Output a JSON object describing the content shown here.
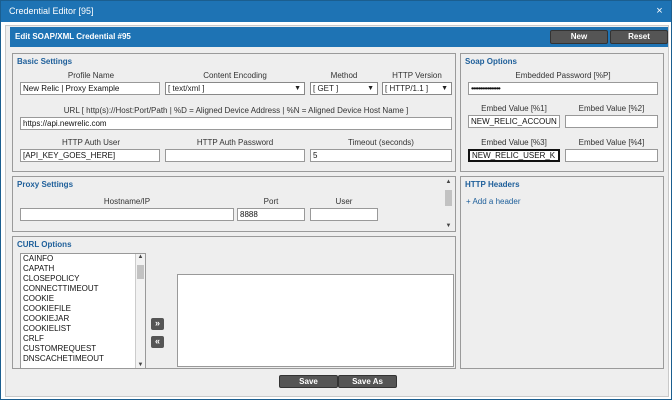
{
  "window": {
    "title": "Credential Editor [95]",
    "close": "×"
  },
  "editor": {
    "heading": "Edit SOAP/XML Credential #95",
    "new_label": "New",
    "reset_label": "Reset"
  },
  "basic": {
    "title": "Basic Settings",
    "profile_name_label": "Profile Name",
    "profile_name": "New Relic | Proxy Example",
    "content_encoding_label": "Content Encoding",
    "content_encoding": "[ text/xml ]",
    "method_label": "Method",
    "method": "[ GET ]",
    "http_version_label": "HTTP Version",
    "http_version": "[ HTTP/1.1 ]",
    "url_label": "URL [ http(s)://Host:Port/Path | %D = Aligned Device Address | %N = Aligned Device Host Name ]",
    "url": "https://api.newrelic.com",
    "auth_user_label": "HTTP Auth User",
    "auth_user": "[API_KEY_GOES_HERE]",
    "auth_password_label": "HTTP Auth Password",
    "auth_password": "",
    "timeout_label": "Timeout (seconds)",
    "timeout": "5"
  },
  "soap": {
    "title": "Soap Options",
    "embedded_password_label": "Embedded Password [%P]",
    "embedded_password": "••••••••••••••••",
    "embed1_label": "Embed Value [%1]",
    "embed1": "NEW_RELIC_ACCOUN",
    "embed2_label": "Embed Value [%2]",
    "embed2": "",
    "embed3_label": "Embed Value [%3]",
    "embed3": "NEW_RELIC_USER_K",
    "embed4_label": "Embed Value [%4]",
    "embed4": ""
  },
  "proxy": {
    "title": "Proxy Settings",
    "hostname_label": "Hostname/IP",
    "hostname": "",
    "port_label": "Port",
    "port": "8888",
    "user_label": "User",
    "user": ""
  },
  "headers": {
    "title": "HTTP Headers",
    "add_label": "Add a header",
    "add_icon": "+"
  },
  "curl": {
    "title": "CURL Options",
    "options": [
      "CAINFO",
      "CAPATH",
      "CLOSEPOLICY",
      "CONNECTTIMEOUT",
      "COOKIE",
      "COOKIEFILE",
      "COOKIEJAR",
      "COOKIELIST",
      "CRLF",
      "CUSTOMREQUEST",
      "DNSCACHETIMEOUT"
    ],
    "add_glyph": "»",
    "remove_glyph": "«"
  },
  "footer": {
    "save_label": "Save",
    "save_as_label": "Save As"
  },
  "colors": {
    "titlebar": "#1e73b4",
    "section_title": "#1e5f9a",
    "button": "#555555"
  }
}
